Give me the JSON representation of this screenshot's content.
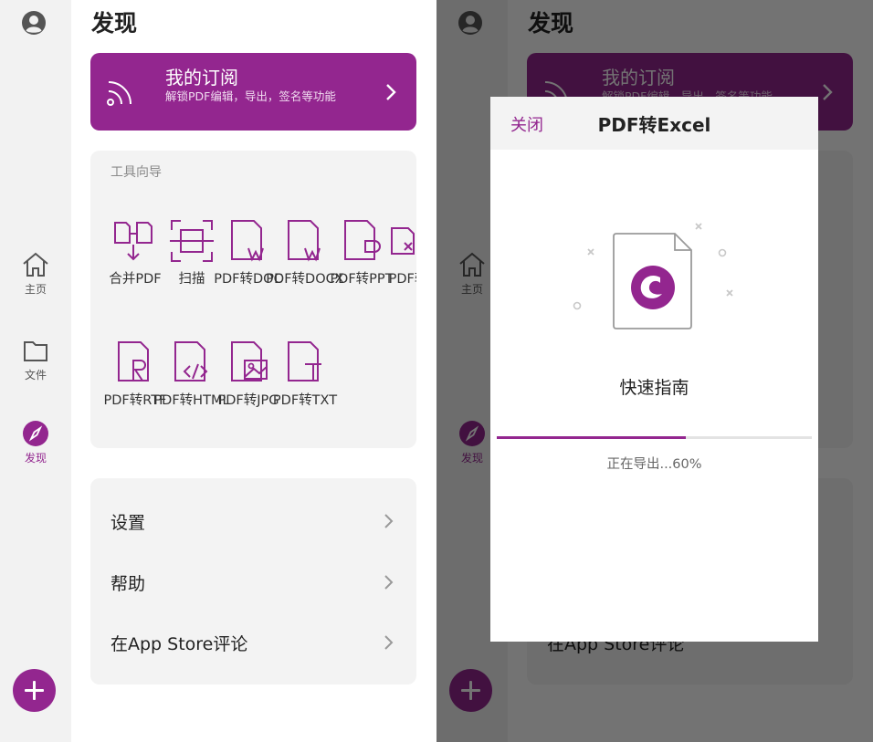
{
  "brand_color": "#93268f",
  "sidebar": {
    "items": [
      {
        "label": "主页",
        "icon": "home-icon"
      },
      {
        "label": "文件",
        "icon": "folder-icon"
      },
      {
        "label": "发现",
        "icon": "compass-icon",
        "active": true
      }
    ],
    "user_icon": "user-circle-icon",
    "fab_icon": "plus-icon"
  },
  "main": {
    "title": "发现",
    "subscription": {
      "title": "我的订阅",
      "description": "解锁PDF编辑，导出，签名等功能"
    },
    "tools": {
      "header": "工具向导",
      "items": [
        {
          "label": "合并PDF",
          "icon": "merge-pdf-icon"
        },
        {
          "label": "扫描",
          "icon": "scan-icon"
        },
        {
          "label": "PDF转DOC",
          "icon": "pdf-to-doc-icon"
        },
        {
          "label": "PDF转DOCX",
          "icon": "pdf-to-docx-icon"
        },
        {
          "label": "PDF转PPT",
          "icon": "pdf-to-ppt-icon"
        },
        {
          "label": "PDF转",
          "icon": "pdf-to-excel-icon"
        },
        {
          "label": "PDF转RTF",
          "icon": "pdf-to-rtf-icon"
        },
        {
          "label": "PDF转HTML",
          "icon": "pdf-to-html-icon"
        },
        {
          "label": "PDF转JPG",
          "icon": "pdf-to-jpg-icon"
        },
        {
          "label": "PDF转TXT",
          "icon": "pdf-to-txt-icon"
        }
      ]
    },
    "settings": [
      {
        "label": "设置"
      },
      {
        "label": "帮助"
      },
      {
        "label": "在App Store评论"
      }
    ]
  },
  "modal": {
    "close_label": "关闭",
    "title": "PDF转Excel",
    "guide_label": "快速指南",
    "progress": 0.6,
    "progress_text": "正在导出...60%"
  }
}
